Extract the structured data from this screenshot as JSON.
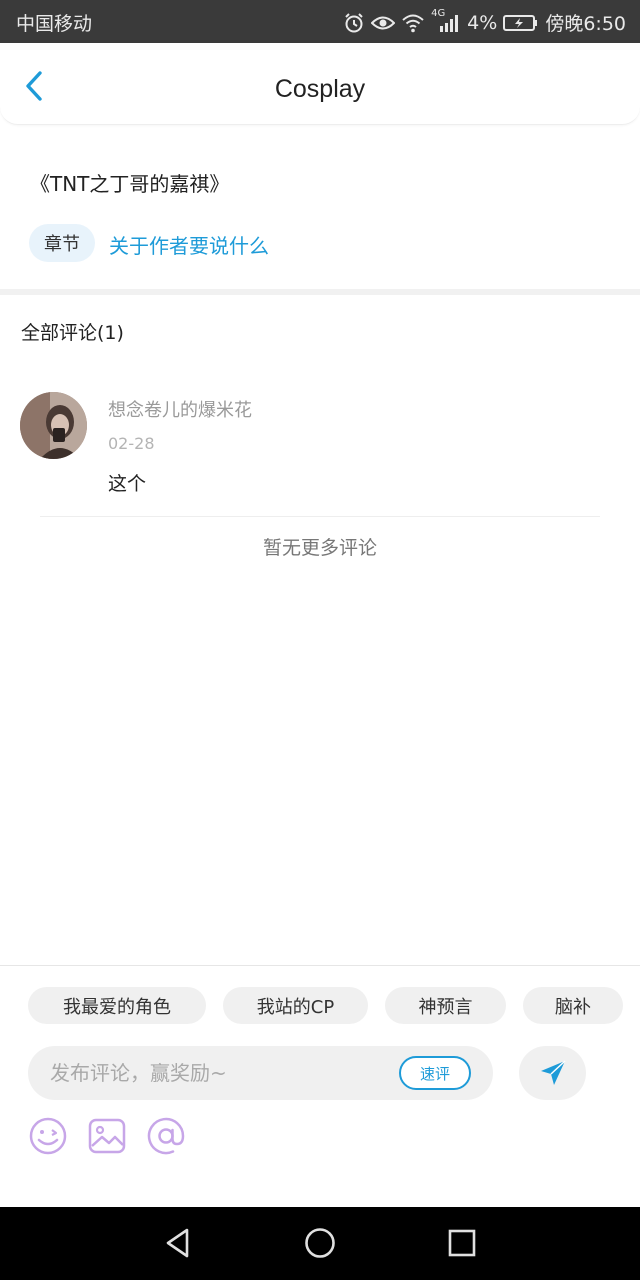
{
  "status_bar": {
    "carrier": "中国移动",
    "network": "4G",
    "battery": "4%",
    "time": "傍晚6:50"
  },
  "header": {
    "title": "Cosplay"
  },
  "article": {
    "title": "《TNT之丁哥的嘉祺》",
    "tag": "章节",
    "link": "关于作者要说什么"
  },
  "comments": {
    "title": "全部评论(1)",
    "items": [
      {
        "user": "想念卷儿的爆米花",
        "date": "02-28",
        "text": "这个"
      }
    ],
    "end_text": "暂无更多评论"
  },
  "composer": {
    "chips": [
      "我最爱的角色",
      "我站的CP",
      "神预言",
      "脑补"
    ],
    "placeholder": "发布评论，赢奖励~",
    "quick_label": "速评",
    "accent": "#1e9bd8",
    "tool_icons": [
      "emoji-icon",
      "image-icon",
      "mention-icon"
    ]
  }
}
